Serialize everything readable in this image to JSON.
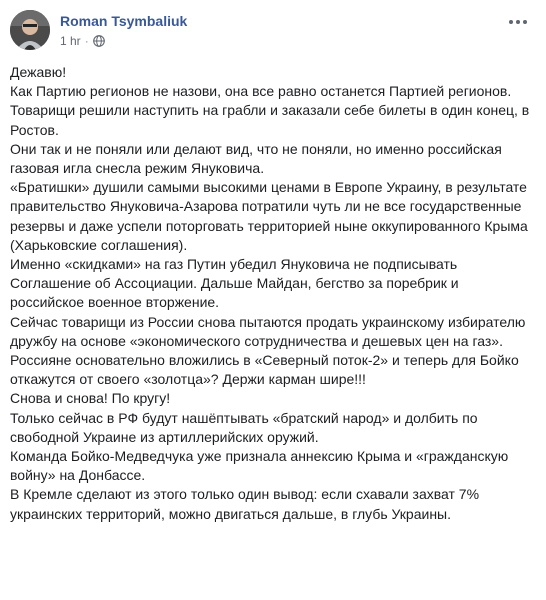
{
  "post": {
    "author": "Roman Tsymbaliuk",
    "time": "1 hr",
    "separator": "·",
    "privacy_icon": "globe-icon",
    "more_icon": "more-options-icon",
    "paragraphs": [
      "Дежавю!",
      "Как Партию регионов не назови, она все равно останется Партией регионов.",
      "Товарищи решили наступить на грабли и заказали себе билеты в один конец, в Ростов.",
      "Они так и не поняли или делают вид, что не поняли, но именно российская газовая игла снесла режим Януковича.",
      "«Братишки» душили самыми высокими ценами в Европе Украину, в результате правительство Януковича-Азарова потратили чуть ли не все государственные резервы и даже успели поторговать территорией ныне оккупированного Крыма (Харьковские соглашения).",
      "Именно «скидками» на газ Путин убедил Януковича не подписывать Соглашение об Ассоциации. Дальше Майдан, бегство за поребрик и российское военное вторжение.",
      "Сейчас товарищи из России снова пытаются продать украинскому избирателю дружбу на основе «экономического сотрудничества и дешевых цен на газ».",
      "Россияне основательно вложились в «Северный поток-2» и теперь для Бойко откажутся от своего «золотца»? Держи карман шире!!!",
      "Снова и снова! По кругу!",
      "Только сейчас в РФ будут нашёптывать «братский народ» и долбить по свободной Украине из артиллерийских оружий.",
      "Команда Бойко-Медведчука уже признала аннексию Крыма и «гражданскую войну» на Донбассе.",
      "В Кремле сделают из этого только один вывод: если схавали захват 7% украинских территорий, можно двигаться дальше, в глубь Украины."
    ]
  },
  "colors": {
    "author": "#385898",
    "meta": "#616770",
    "text": "#1c1e21",
    "background": "#ffffff"
  }
}
